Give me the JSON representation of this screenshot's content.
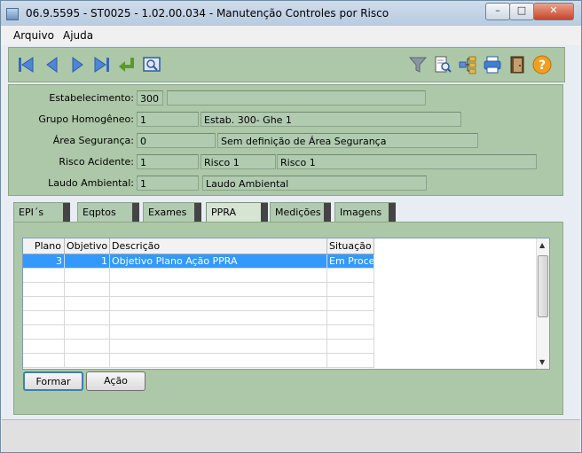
{
  "window": {
    "title": "06.9.5595 - ST0025 - 1.02.00.034 - Manutenção Controles por Risco",
    "minimize_glyph": "–",
    "maximize_glyph": "□",
    "close_glyph": "✕"
  },
  "menu": [
    "Arquivo",
    "Ajuda"
  ],
  "toolbar": {
    "nav_icons": [
      "first-icon",
      "previous-icon",
      "next-icon",
      "last-icon",
      "return-icon",
      "zoom-icon"
    ],
    "tool_icons": [
      "filter-icon",
      "document-search-icon",
      "hierarchy-icon",
      "print-icon",
      "exit-door-icon",
      "help-icon"
    ],
    "help_glyph": "?"
  },
  "form": {
    "estabelecimento": {
      "label": "Estabelecimento:",
      "code": "300",
      "desc": ""
    },
    "grupo": {
      "label": "Grupo Homogêneo:",
      "code": "1",
      "desc": "Estab. 300- Ghe 1"
    },
    "area": {
      "label": "Área Segurança:",
      "code": "0",
      "desc": "Sem definição de Área Segurança"
    },
    "risco": {
      "label": "Risco Acidente:",
      "code": "1",
      "desc1": "Risco 1",
      "desc2": "Risco 1"
    },
    "laudo": {
      "label": "Laudo Ambiental:",
      "code": "1",
      "desc": "Laudo Ambiental"
    }
  },
  "tabs": [
    {
      "label": "EPI´s"
    },
    {
      "label": "Eqptos"
    },
    {
      "label": "Exames"
    },
    {
      "label": "PPRA",
      "active": true
    },
    {
      "label": "Medições"
    },
    {
      "label": "Imagens"
    }
  ],
  "grid": {
    "columns": [
      "Plano",
      "Objetivo",
      "Descrição",
      "Situação"
    ],
    "rows": [
      {
        "plano": "3",
        "objetivo": "1",
        "descricao": "Objetivo Plano Ação PPRA",
        "situacao": "Em Proce"
      }
    ]
  },
  "buttons": {
    "formar": "Formar",
    "acao": "Ação"
  },
  "colors": {
    "panel": "#adc8a8",
    "field": "#b0cbb0",
    "selection": "#3399ff"
  }
}
